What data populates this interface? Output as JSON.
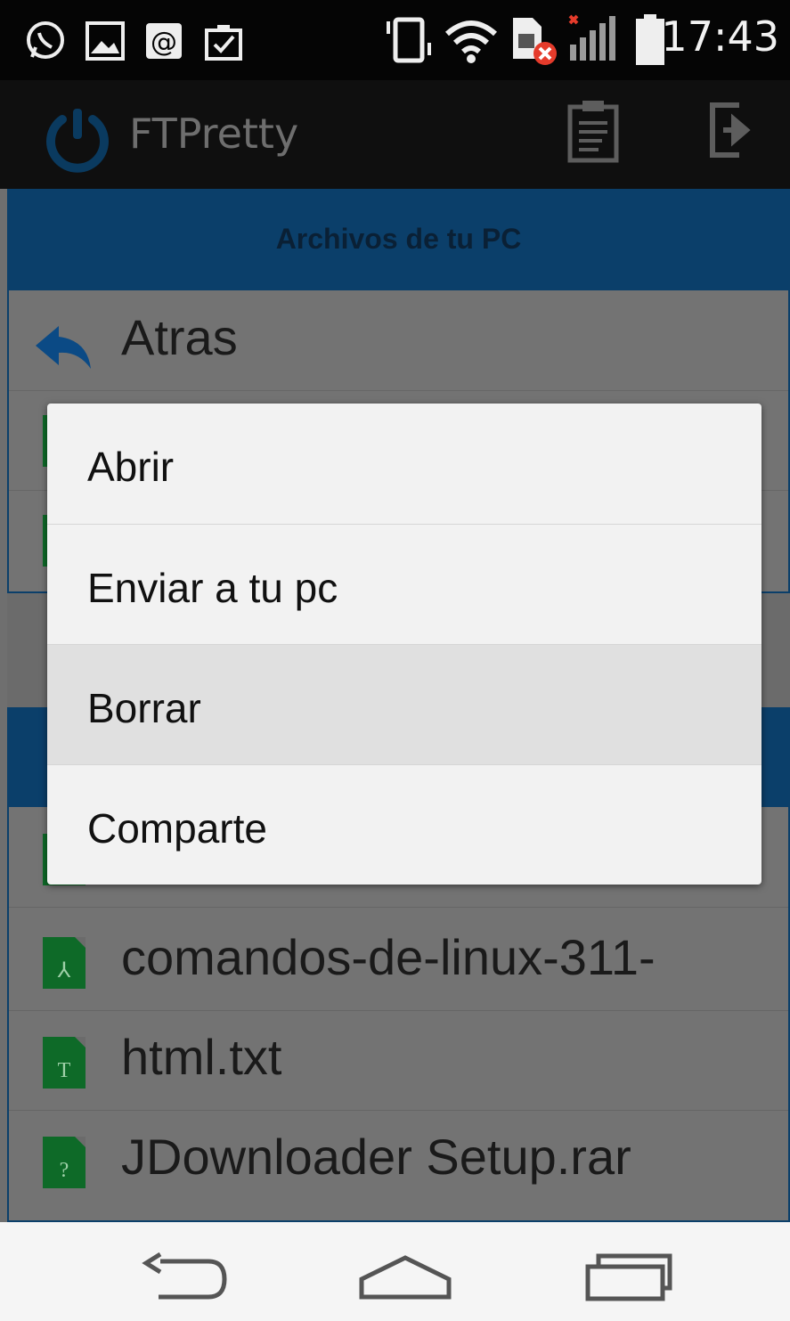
{
  "status_bar": {
    "time": "17:43",
    "icons": [
      "whatsapp-icon",
      "image-icon",
      "at-icon",
      "clipboard-check-icon",
      "vibrate-icon",
      "wifi-icon",
      "sim-error-icon",
      "signal-icon",
      "battery-icon"
    ]
  },
  "action_bar": {
    "app_title": "FTPretty",
    "icons": [
      "power-logo-icon",
      "clipboard-icon",
      "exit-icon"
    ]
  },
  "pc_section": {
    "header": "Archivos de tu PC",
    "back_label": "Atras"
  },
  "phone_files": [
    {
      "name": "comandos-de-linux-311-",
      "icon": "pdf-file-icon",
      "glyph": "⅄"
    },
    {
      "name": "html.txt",
      "icon": "text-file-icon",
      "glyph": "T"
    },
    {
      "name": "JDownloader Setup.rar",
      "icon": "unknown-file-icon",
      "glyph": "?"
    }
  ],
  "context_menu": {
    "items": [
      {
        "label": "Abrir"
      },
      {
        "label": "Enviar a tu pc"
      },
      {
        "label": "Borrar"
      },
      {
        "label": "Comparte"
      }
    ]
  },
  "nav_bar": {
    "icons": [
      "back-icon",
      "home-icon",
      "recents-icon"
    ]
  },
  "colors": {
    "accent_blue": "#0b5fa5",
    "file_icon_green": "#1b8a3a"
  }
}
